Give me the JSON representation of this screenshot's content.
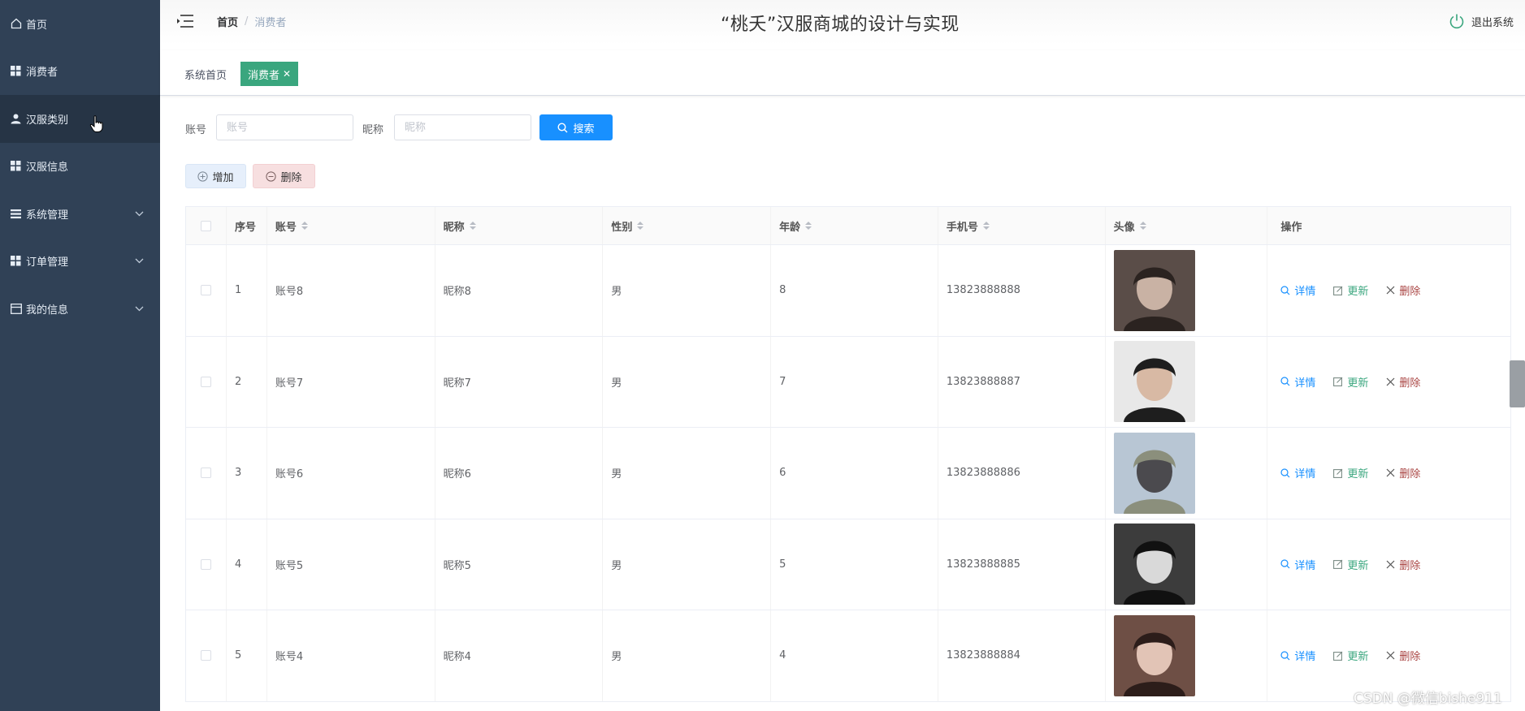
{
  "sidebar": {
    "items": [
      {
        "label": "首页",
        "icon": "home-icon"
      },
      {
        "label": "消费者",
        "icon": "grid-icon"
      },
      {
        "label": "汉服类别",
        "icon": "user-icon"
      },
      {
        "label": "汉服信息",
        "icon": "grid-icon"
      },
      {
        "label": "系统管理",
        "icon": "list-icon",
        "expandable": true
      },
      {
        "label": "订单管理",
        "icon": "grid-icon",
        "expandable": true
      },
      {
        "label": "我的信息",
        "icon": "card-icon",
        "expandable": true
      }
    ]
  },
  "header": {
    "breadcrumb": {
      "home": "首页",
      "sep": "/",
      "current": "消费者"
    },
    "title": "“桃夭”汉服商城的设计与实现",
    "logout": "退出系统"
  },
  "tags": {
    "home": "系统首页",
    "active": "消费者",
    "close": "✕"
  },
  "search": {
    "account_label": "账号",
    "account_placeholder": "账号",
    "nickname_label": "昵称",
    "nickname_placeholder": "昵称",
    "search_button": "搜索"
  },
  "actions": {
    "add": "增加",
    "delete": "删除"
  },
  "table": {
    "headers": {
      "no": "序号",
      "account": "账号",
      "nickname": "昵称",
      "sex": "性别",
      "age": "年龄",
      "phone": "手机号",
      "avatar": "头像",
      "ops": "操作"
    },
    "op_labels": {
      "detail": "详情",
      "update": "更新",
      "delete": "删除"
    },
    "rows": [
      {
        "no": "1",
        "account": "账号8",
        "nickname": "昵称8",
        "sex": "男",
        "age": "8",
        "phone": "13823888888"
      },
      {
        "no": "2",
        "account": "账号7",
        "nickname": "昵称7",
        "sex": "男",
        "age": "7",
        "phone": "13823888887"
      },
      {
        "no": "3",
        "account": "账号6",
        "nickname": "昵称6",
        "sex": "男",
        "age": "6",
        "phone": "13823888886"
      },
      {
        "no": "4",
        "account": "账号5",
        "nickname": "昵称5",
        "sex": "男",
        "age": "5",
        "phone": "13823888885"
      },
      {
        "no": "5",
        "account": "账号4",
        "nickname": "昵称4",
        "sex": "男",
        "age": "4",
        "phone": "13823888884"
      }
    ]
  },
  "watermark": "CSDN @微信bishe911",
  "colors": {
    "sidebar": "#304156",
    "primary": "#1890ff",
    "tag_active": "#3aa67e",
    "danger": "#a94442"
  }
}
